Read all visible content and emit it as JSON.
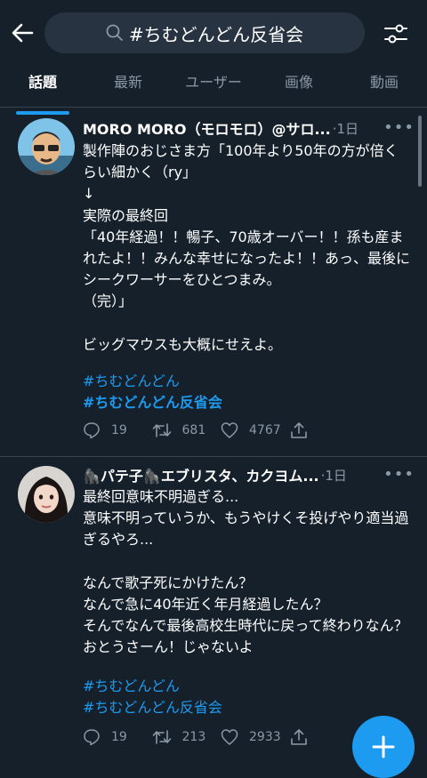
{
  "search": {
    "query": "#ちむどんどん反省会"
  },
  "tabs": [
    "話題",
    "最新",
    "ユーザー",
    "画像",
    "動画"
  ],
  "tweets": [
    {
      "name": "MORO MORO（モロモロ）@サロ...",
      "time": "·1日",
      "body": "製作陣のおじさま方「100年より50年の方が倍くらい細かく（ry」\n↓\n実際の最終回\n「40年経過！！暢子、70歳オーバー！！孫も産まれたよ！！みんな幸せになったよ！！あっ、最後にシークワーサーをひとつまみ。\n（完）」\n\nビッグマウスも大概にせえよ。",
      "tags": [
        "#ちむどんどん",
        "#ちむどんどん反省会"
      ],
      "replies": "19",
      "retweets": "681",
      "likes": "4767"
    },
    {
      "name": "🦍パテ子🦍エブリスタ、カクヨム...",
      "time": "·1日",
      "body": "最終回意味不明過ぎる...\n意味不明っていうか、もうやけくそ投げやり適当過ぎるやろ...\n\nなんで歌子死にかけたん？\nなんで急に40年近く年月経過したん？\nそんでなんで最後高校生時代に戻って終わりなん？\nおとうさーん！じゃないよ",
      "tags": [
        " #ちむどんどん",
        " #ちむどんどん反省会"
      ],
      "replies": "19",
      "retweets": "213",
      "likes": "2933"
    }
  ],
  "colors": {
    "background": "#15202b",
    "accent": "#1d9bf0",
    "muted": "#8b98a5"
  },
  "icons": [
    "back-arrow-icon",
    "search-icon",
    "filter-icon",
    "reply-icon",
    "retweet-icon",
    "like-icon",
    "share-icon",
    "plus-icon",
    "more-icon"
  ]
}
